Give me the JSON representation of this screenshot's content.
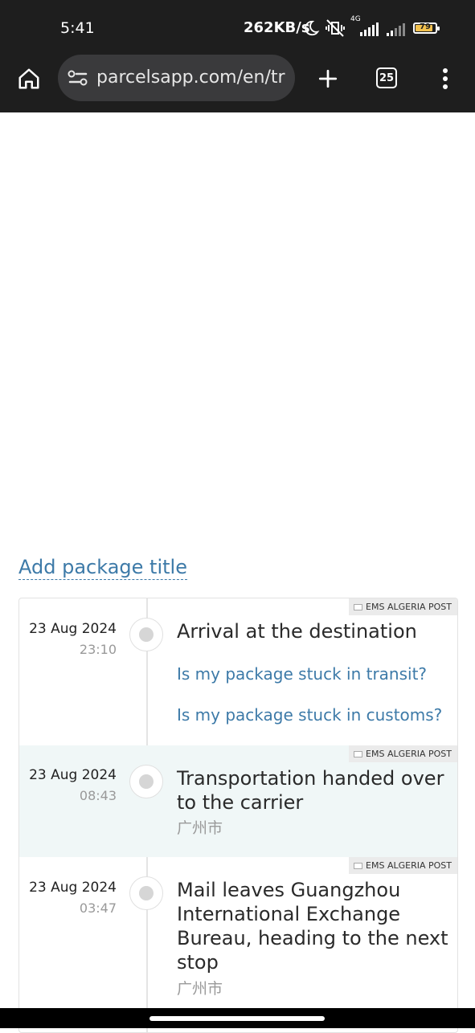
{
  "status_bar": {
    "time": "5:41",
    "network_speed": "262KB/s",
    "network_type": "4G",
    "battery_level": "79",
    "battery_color": "#f2c14e",
    "icons": [
      "moon-icon",
      "vibrate-off-icon",
      "signal-4g-icon",
      "signal-icon",
      "battery-icon"
    ]
  },
  "browser": {
    "url": "parcelsapp.com/en/tr",
    "tab_count": "25",
    "icons": [
      "home-icon",
      "site-settings-icon",
      "new-tab-plus-icon",
      "tab-switcher-icon",
      "menu-dots-icon"
    ]
  },
  "package": {
    "add_title_link": "Add package title"
  },
  "timeline": {
    "events": [
      {
        "carrier": "EMS ALGERIA POST",
        "date": "23 Aug 2024",
        "time": "23:10",
        "title": "Arrival at the destination",
        "links": [
          "Is my package stuck in transit?",
          "Is my package stuck in customs?"
        ]
      },
      {
        "carrier": "EMS ALGERIA POST",
        "date": "23 Aug 2024",
        "time": "08:43",
        "title": "Transportation handed over to the carrier",
        "location": "广州市"
      },
      {
        "carrier": "EMS ALGERIA POST",
        "date": "23 Aug 2024",
        "time": "03:47",
        "title": "Mail leaves Guangzhou International Exchange Bureau, heading to the next stop",
        "location": "广州市"
      }
    ]
  },
  "colors": {
    "link": "#3d7aa8",
    "highlight_row": "#f0f7f7",
    "chrome_background": "#1e1e1e"
  }
}
